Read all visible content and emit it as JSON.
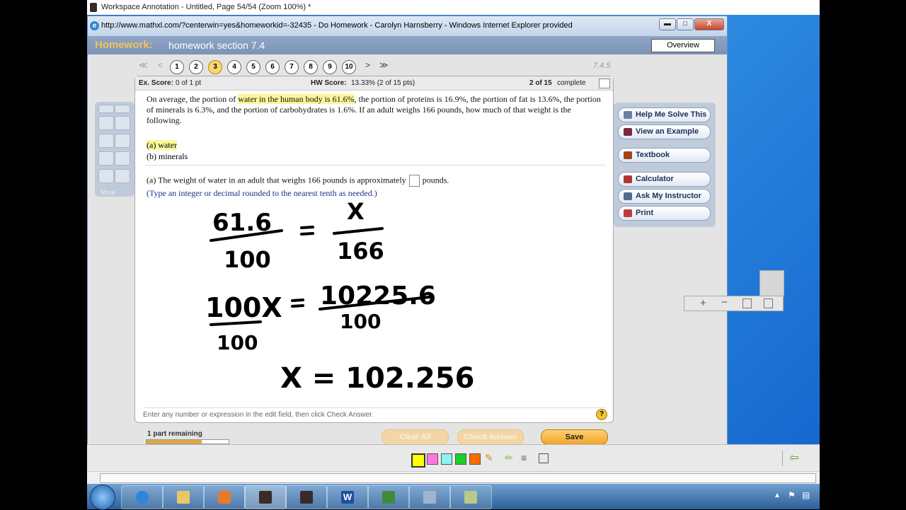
{
  "outer_window": {
    "title": "Workspace Annotation - Untitled, Page 54/54  (Zoom 100%) *"
  },
  "ie_window": {
    "title": "http://www.mathxl.com/?centerwin=yes&homeworkid=-32435 - Do Homework - Carolyn Harnsberry - Windows Internet Explorer provided",
    "controls": {
      "minimize": "▬",
      "maximize": "□",
      "close": "X"
    }
  },
  "homework": {
    "label": "Homework:",
    "title": "homework section 7.4",
    "overview_button": "Overview",
    "version": "7.4.5"
  },
  "question_nav": {
    "first": "≪",
    "prev": "<",
    "next": ">",
    "last": "≫",
    "items": [
      "1",
      "2",
      "3",
      "4",
      "5",
      "6",
      "7",
      "8",
      "9",
      "10"
    ],
    "current": "3"
  },
  "score": {
    "ex_label": "Ex. Score:",
    "ex_value": "0 of 1 pt",
    "hw_label": "HW Score:",
    "hw_value": "13.33% (2 of 15 pts)",
    "complete_bold": "2 of 15",
    "complete_text": "complete"
  },
  "question": {
    "p1": "On average, the portion of ",
    "p1_hl": "water in the human body is 61.6%",
    "p1_rest": ", the portion of proteins is 16.9%, the portion of fat is 13.6%, the portion of minerals is 6.3%, and the portion of carbohydrates is 1.6%. If an adult weighs 166 pounds, how much of that weight is the following.",
    "part_a": "(a) water",
    "part_b": "(b) minerals",
    "answer_prefix": "(a) The weight of water in an adult that weighs 166 pounds is approximately",
    "answer_suffix": "pounds.",
    "hint": "(Type an integer or decimal rounded to the nearest tenth as needed.)",
    "instruction": "Enter any number or expression in the edit field, then click Check Answer.",
    "help": "?"
  },
  "handwriting": {
    "line1_num": "61.6",
    "line1_den": "100",
    "eq": "=",
    "line1_rnum": "X",
    "line1_rden": "166",
    "line2_left": "100X",
    "line2_den": "100",
    "line2_rnum": "10225.6",
    "line2_rden": "100",
    "line3": "X = 102.256"
  },
  "left_tools": {
    "more": "More"
  },
  "right_panel": {
    "buttons": [
      "Help Me Solve This",
      "View an Example",
      "Textbook",
      "Calculator",
      "Ask My Instructor",
      "Print"
    ]
  },
  "bottom": {
    "remaining": "1 part remaining",
    "progress": 0.67,
    "clear_all": "Clear All",
    "check_answer": "Check Answer",
    "save": "Save"
  },
  "annotation_colors": [
    "#ffff00",
    "#ff77e0",
    "#8af5f0",
    "#18d02a",
    "#ff6a00"
  ],
  "taskbar": {
    "word_icon": "W"
  }
}
